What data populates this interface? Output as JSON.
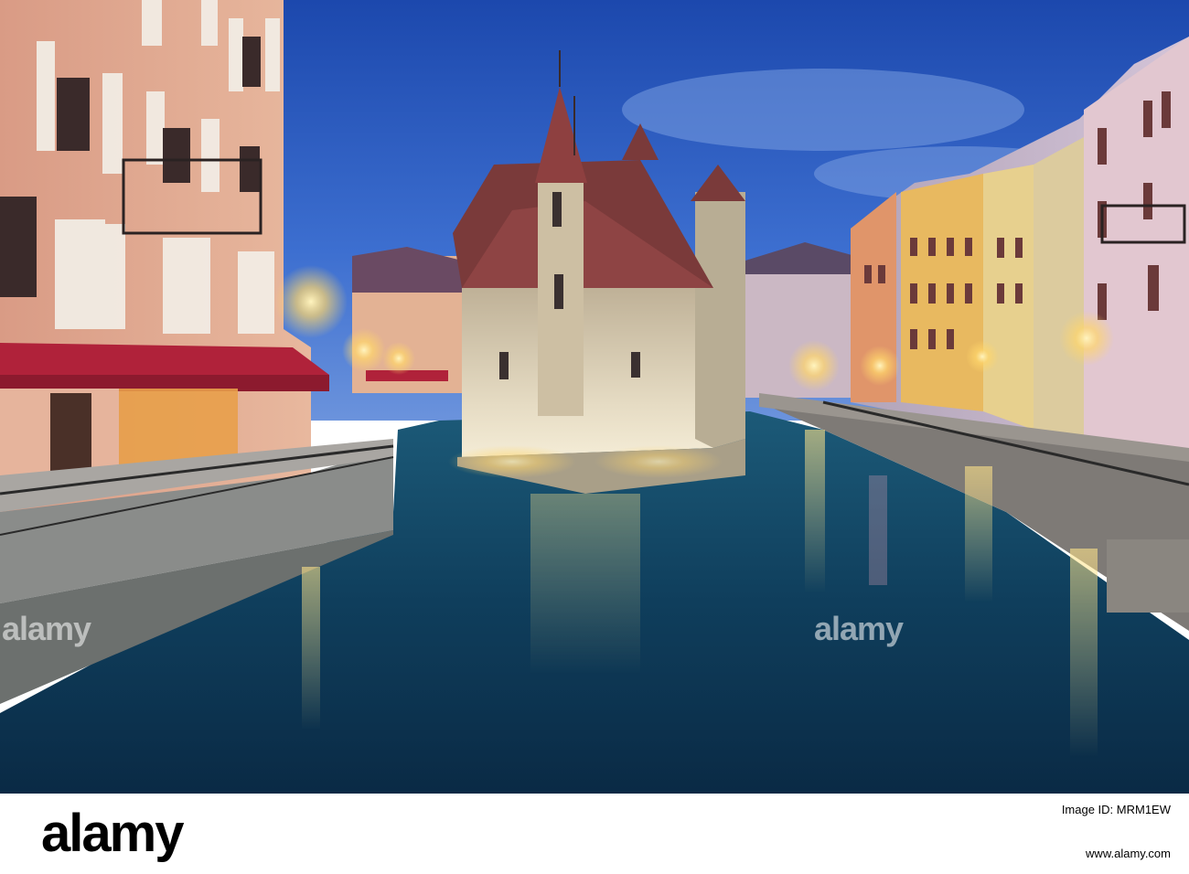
{
  "photo": {
    "subject": "",
    "palette": {
      "sky_top": "#1e4fb8",
      "sky_bottom": "#5b8ae0",
      "water_deep": "#0d3050",
      "water_mid": "#1a5c78",
      "castle_wall": "#d9cdb4",
      "roof": "#7a3a3a",
      "awning": "#b0223a",
      "lamp_glow": "#ffd66b"
    }
  },
  "watermarks": {
    "left": "alamy",
    "right": "alamy"
  },
  "footer": {
    "logo": "alamy",
    "image_id": "Image ID: MRM1EW",
    "website": "www.alamy.com"
  }
}
